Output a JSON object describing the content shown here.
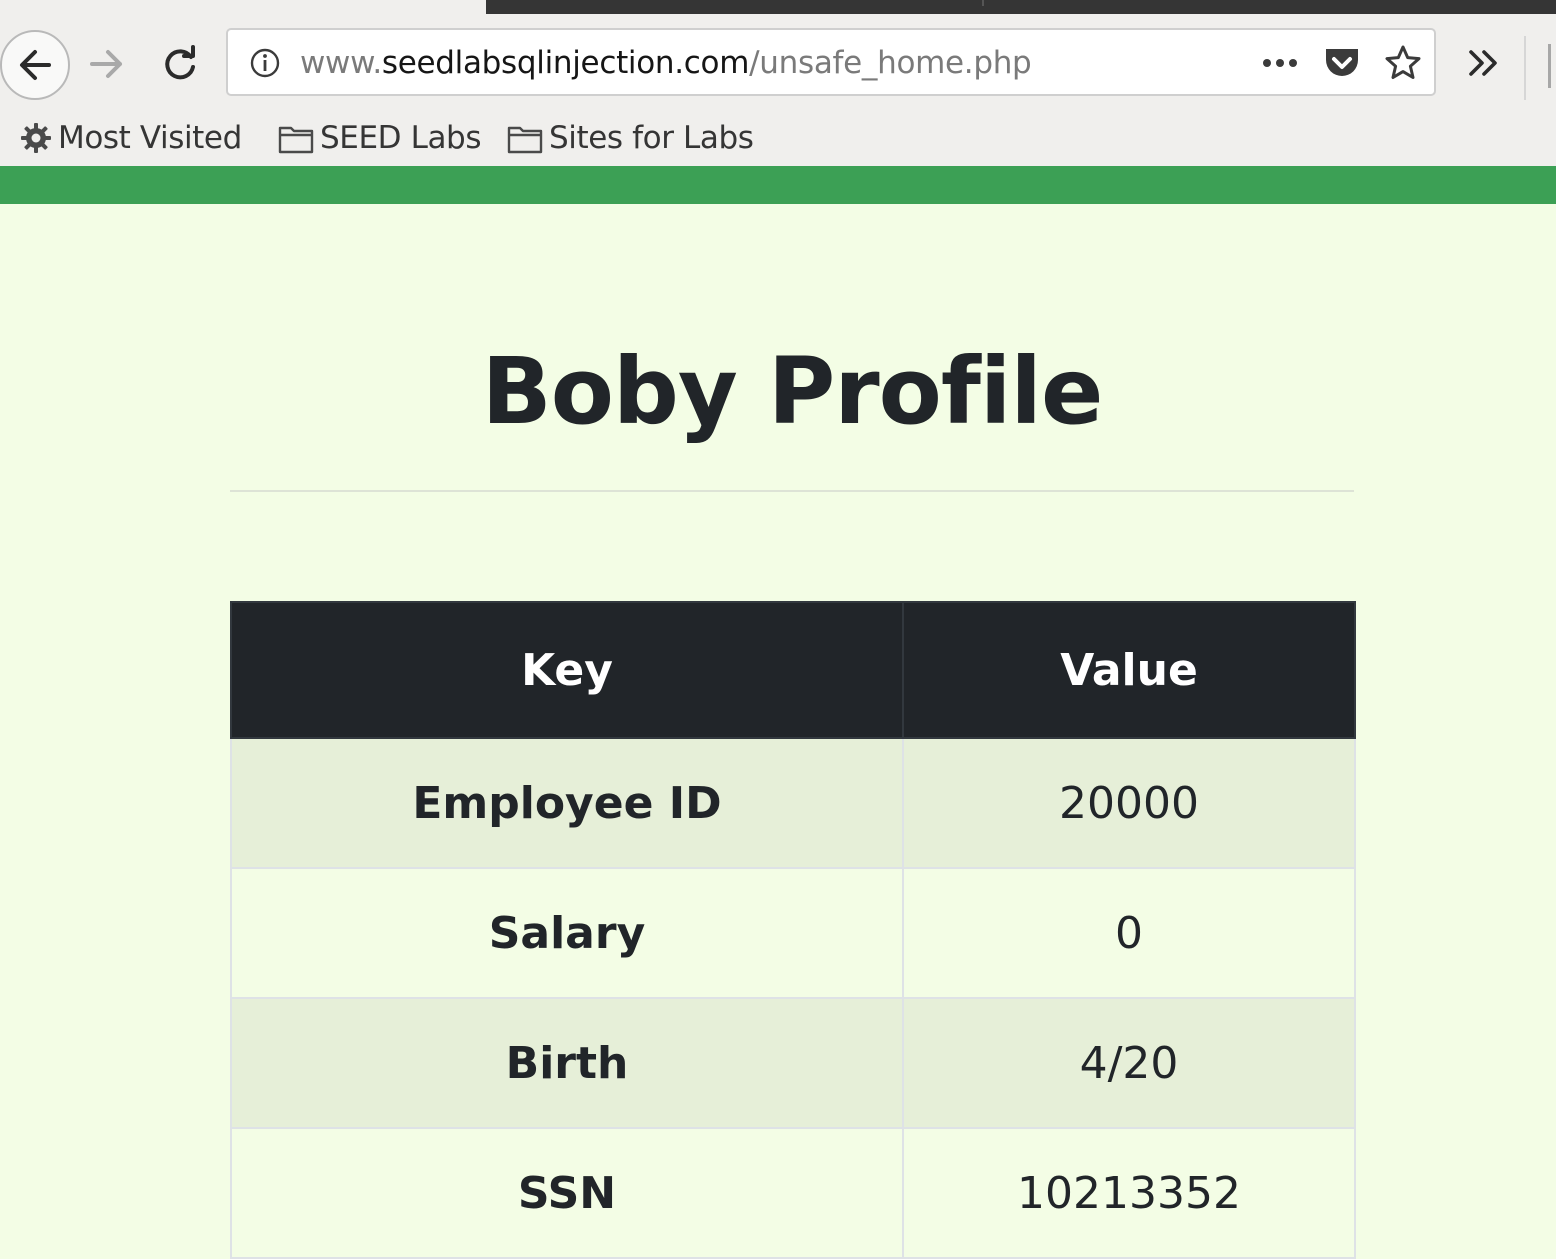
{
  "browser": {
    "url_prefix": "www.",
    "url_domain": "seedlabsqlinjection.com",
    "url_path": "/unsafe_home.php",
    "bookmarks": [
      {
        "label": "Most Visited",
        "icon": "gear-icon"
      },
      {
        "label": "SEED Labs",
        "icon": "folder-icon"
      },
      {
        "label": "Sites for Labs",
        "icon": "folder-icon"
      }
    ]
  },
  "page": {
    "title": "Boby Profile",
    "table": {
      "headers": [
        "Key",
        "Value"
      ],
      "rows": [
        {
          "key": "Employee ID",
          "value": "20000"
        },
        {
          "key": "Salary",
          "value": "0"
        },
        {
          "key": "Birth",
          "value": "4/20"
        },
        {
          "key": "SSN",
          "value": "10213352"
        }
      ]
    }
  },
  "colors": {
    "nav_green": "#3ca055",
    "page_bg": "#f3fde5",
    "table_header_bg": "#212529",
    "striped_row_bg": "#e6efd8"
  }
}
